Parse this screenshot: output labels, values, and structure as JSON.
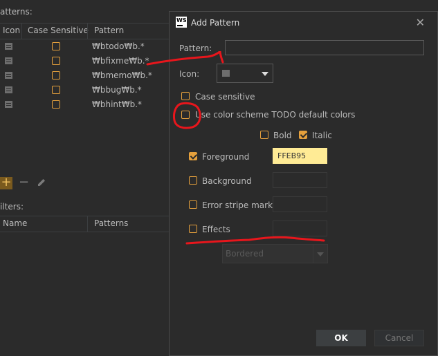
{
  "todo_panel": {
    "patterns_label": "atterns:",
    "columns": [
      "Icon",
      "Case Sensitive",
      "Pattern"
    ],
    "rows": [
      {
        "pattern": "₩btodo₩b.*"
      },
      {
        "pattern": "₩bfixme₩b.*"
      },
      {
        "pattern": "₩bmemo₩b.*"
      },
      {
        "pattern": "₩bbug₩b.*"
      },
      {
        "pattern": "₩bhint₩b.*"
      }
    ],
    "toolbar": {
      "add": "+",
      "remove": "−"
    },
    "filters_label": "ilters:",
    "filter_columns": [
      "Name",
      "Patterns"
    ]
  },
  "dialog": {
    "logo_text": "WS",
    "title": "Add Pattern",
    "close": "✕",
    "pattern_label": "Pattern:",
    "pattern_value": "",
    "icon_label": "Icon:",
    "case_sensitive_label": "Case sensitive",
    "case_sensitive_checked": false,
    "use_color_scheme_label": "Use color scheme TODO default colors",
    "use_color_scheme_checked": false,
    "bold_label": "Bold",
    "bold_checked": false,
    "italic_label": "Italic",
    "italic_checked": true,
    "foreground_label": "Foreground",
    "foreground_checked": true,
    "foreground_value": "FFEB95",
    "background_label": "Background",
    "background_checked": false,
    "error_stripe_label": "Error stripe mark",
    "error_stripe_checked": false,
    "effects_label": "Effects",
    "effects_checked": false,
    "effect_type": "Bordered",
    "ok_label": "OK",
    "cancel_label": "Cancel"
  },
  "colors": {
    "accent": "#e5a03c",
    "foreground_swatch": "#ffeb95",
    "annotation": "#e8161c"
  }
}
